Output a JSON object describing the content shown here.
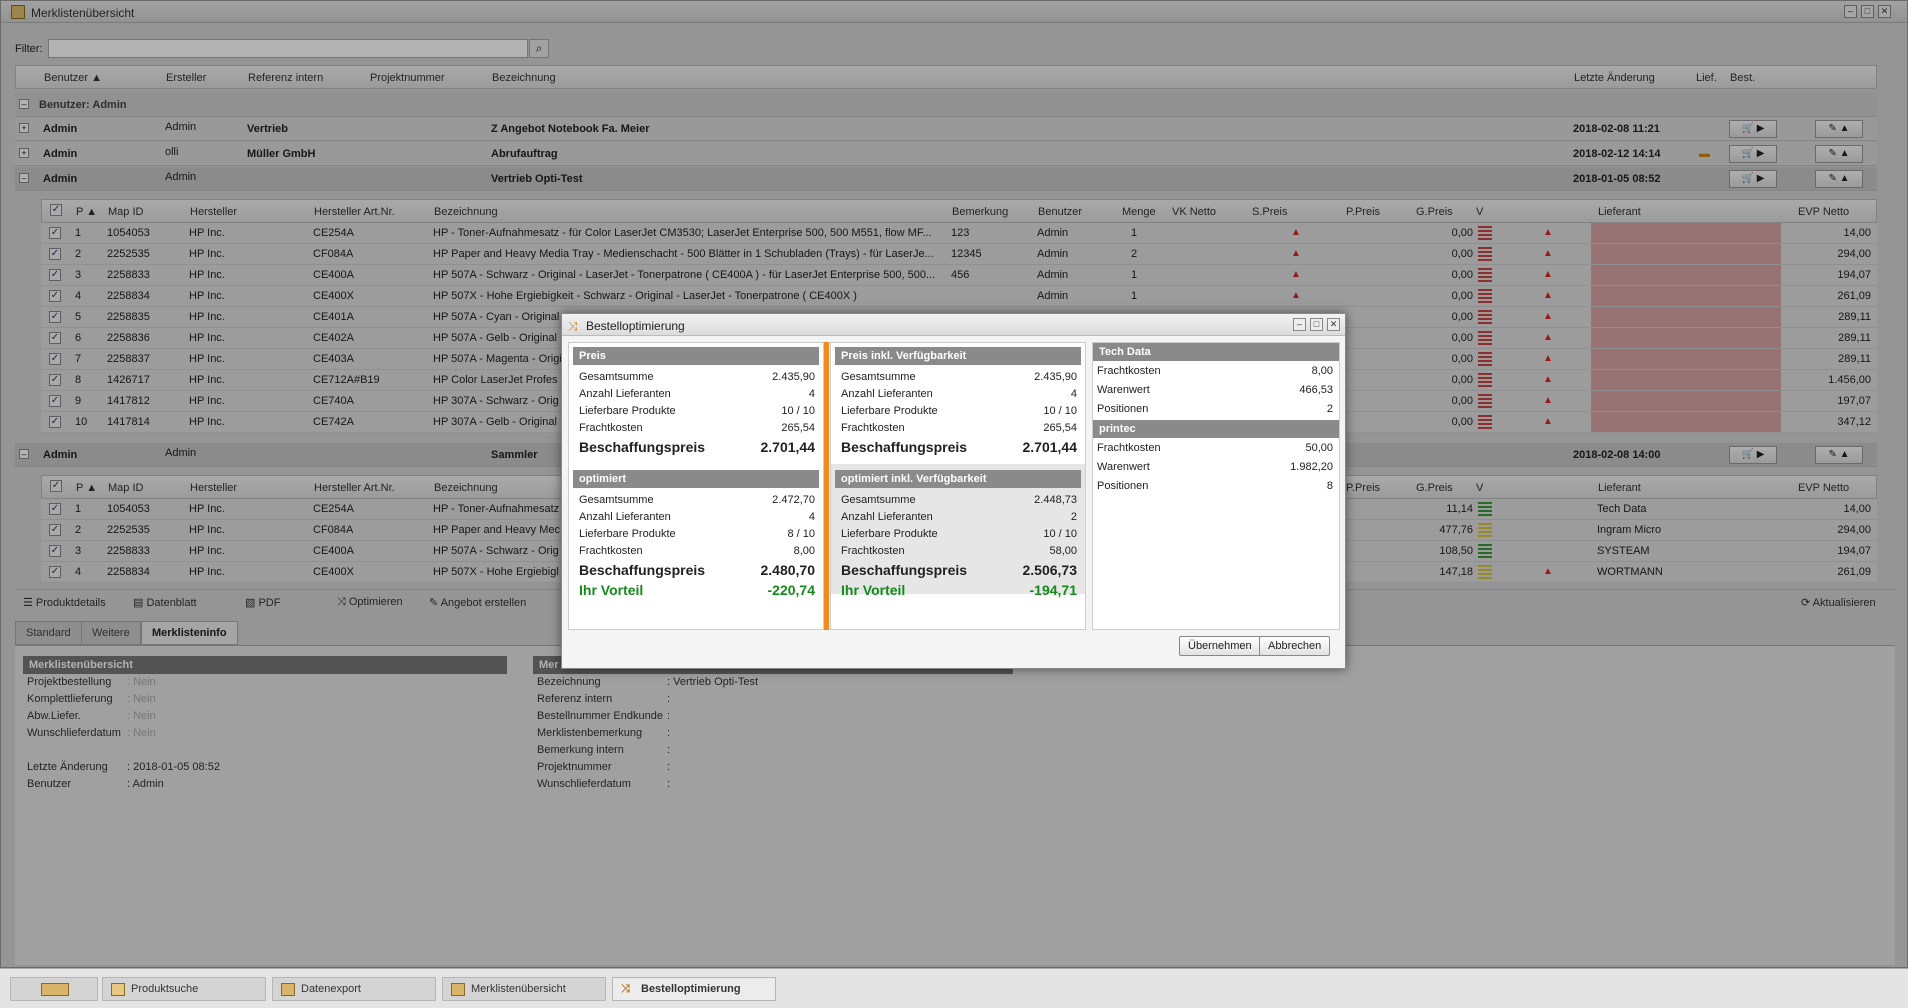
{
  "window": {
    "title": "Merklistenübersicht"
  },
  "filter": {
    "label": "Filter:",
    "value": ""
  },
  "grid": {
    "headers": [
      "Benutzer ▲",
      "Ersteller",
      "Referenz intern",
      "Projektnummer",
      "Bezeichnung",
      "Letzte Änderung",
      "Lief.",
      "Best."
    ],
    "group_label": "Benutzer: Admin",
    "groups": [
      {
        "benutzer": "Admin",
        "ersteller": "Admin",
        "referenz": "Vertrieb",
        "bezeichnung": "Z Angebot Notebook Fa. Meier",
        "date": "2018-02-08 11:21"
      },
      {
        "benutzer": "Admin",
        "ersteller": "olli",
        "referenz": "Müller GmbH",
        "bezeichnung": "Abrufauftrag",
        "date": "2018-02-12 14:14"
      },
      {
        "benutzer": "Admin",
        "ersteller": "Admin",
        "referenz": "",
        "bezeichnung": "Vertrieb Opti-Test",
        "date": "2018-01-05 08:52"
      },
      {
        "benutzer": "Admin",
        "ersteller": "Admin",
        "referenz": "",
        "bezeichnung": "Sammler",
        "date": "2018-02-08 14:00"
      }
    ]
  },
  "inner1": {
    "headers": [
      "P ▲",
      "Map ID",
      "Hersteller",
      "Hersteller Art.Nr.",
      "Bezeichnung",
      "Bemerkung",
      "Benutzer",
      "Menge",
      "VK Netto",
      "S.Preis",
      "P.Preis",
      "G.Preis",
      "V",
      "Lieferant",
      "EVP Netto"
    ],
    "rows": [
      {
        "p": "1",
        "map": "1054053",
        "her": "HP Inc.",
        "art": "CE254A",
        "bez": "HP - Toner-Aufnahmesatz - für Color LaserJet CM3530; LaserJet Enterprise 500, 500 M551, flow MF...",
        "bem": "123",
        "ben": "Admin",
        "menge": "1",
        "g": "0,00",
        "evp": "14,00"
      },
      {
        "p": "2",
        "map": "2252535",
        "her": "HP Inc.",
        "art": "CF084A",
        "bez": "HP Paper and Heavy Media Tray - Medienschacht - 500 Blätter in 1 Schubladen (Trays) - für LaserJe...",
        "bem": "12345",
        "ben": "Admin",
        "menge": "2",
        "g": "0,00",
        "evp": "294,00"
      },
      {
        "p": "3",
        "map": "2258833",
        "her": "HP Inc.",
        "art": "CE400A",
        "bez": "HP 507A - Schwarz - Original - LaserJet - Tonerpatrone ( CE400A ) - für LaserJet Enterprise 500, 500...",
        "bem": "456",
        "ben": "Admin",
        "menge": "1",
        "g": "0,00",
        "evp": "194,07"
      },
      {
        "p": "4",
        "map": "2258834",
        "her": "HP Inc.",
        "art": "CE400X",
        "bez": "HP 507X - Hohe Ergiebigkeit - Schwarz - Original - LaserJet - Tonerpatrone ( CE400X )",
        "bem": "",
        "ben": "Admin",
        "menge": "1",
        "g": "0,00",
        "evp": "261,09"
      },
      {
        "p": "5",
        "map": "2258835",
        "her": "HP Inc.",
        "art": "CE401A",
        "bez": "HP 507A - Cyan - Original",
        "bem": "",
        "ben": "",
        "menge": "",
        "g": "0,00",
        "evp": "289,11"
      },
      {
        "p": "6",
        "map": "2258836",
        "her": "HP Inc.",
        "art": "CE402A",
        "bez": "HP 507A - Gelb - Original",
        "bem": "",
        "ben": "",
        "menge": "",
        "g": "0,00",
        "evp": "289,11"
      },
      {
        "p": "7",
        "map": "2258837",
        "her": "HP Inc.",
        "art": "CE403A",
        "bez": "HP 507A - Magenta - Origi",
        "bem": "",
        "ben": "",
        "menge": "",
        "g": "0,00",
        "evp": "289,11"
      },
      {
        "p": "8",
        "map": "1426717",
        "her": "HP Inc.",
        "art": "CE712A#B19",
        "bez": "HP Color LaserJet Profes",
        "bem": "",
        "ben": "",
        "menge": "",
        "g": "0,00",
        "evp": "1.456,00"
      },
      {
        "p": "9",
        "map": "1417812",
        "her": "HP Inc.",
        "art": "CE740A",
        "bez": "HP 307A - Schwarz - Orig",
        "bem": "",
        "ben": "",
        "menge": "",
        "g": "0,00",
        "evp": "197,07"
      },
      {
        "p": "10",
        "map": "1417814",
        "her": "HP Inc.",
        "art": "CE742A",
        "bez": "HP 307A - Gelb - Original",
        "bem": "",
        "ben": "",
        "menge": "",
        "g": "0,00",
        "evp": "347,12"
      }
    ]
  },
  "inner2": {
    "headers": [
      "P ▲",
      "Map ID",
      "Hersteller",
      "Hersteller Art.Nr.",
      "Bezeichnung",
      "P.Preis",
      "G.Preis",
      "V",
      "Lieferant",
      "EVP Netto"
    ],
    "rows": [
      {
        "p": "1",
        "map": "1054053",
        "her": "HP Inc.",
        "art": "CE254A",
        "bez": "HP - Toner-Aufnahmesatz",
        "g": "11,14",
        "lief": "Tech Data",
        "evp": "14,00"
      },
      {
        "p": "2",
        "map": "2252535",
        "her": "HP Inc.",
        "art": "CF084A",
        "bez": "HP Paper and Heavy Mec",
        "g": "477,76",
        "lief": "Ingram Micro",
        "evp": "294,00"
      },
      {
        "p": "3",
        "map": "2258833",
        "her": "HP Inc.",
        "art": "CE400A",
        "bez": "HP 507A - Schwarz - Orig",
        "g": "108,50",
        "lief": "SYSTEAM",
        "evp": "194,07"
      },
      {
        "p": "4",
        "map": "2258834",
        "her": "HP Inc.",
        "art": "CE400X",
        "bez": "HP 507X - Hohe Ergiebigl",
        "g": "147,18",
        "lief": "WORTMANN",
        "evp": "261,09"
      }
    ]
  },
  "toolbar": {
    "items": [
      "Produktdetails",
      "Datenblatt",
      "PDF",
      "Optimieren",
      "Angebot erstellen"
    ],
    "refresh": "Aktualisieren"
  },
  "tabs": [
    "Standard",
    "Weitere",
    "Merklisteninfo"
  ],
  "info": {
    "left_title": "Merklistenübersicht",
    "left": [
      {
        "k": "Projektbestellung",
        "v": ": Nein"
      },
      {
        "k": "Komplettlieferung",
        "v": ": Nein"
      },
      {
        "k": "Abw.Liefer.",
        "v": ": Nein"
      },
      {
        "k": "Wunschlieferdatum",
        "v": ": Nein"
      },
      {
        "k": "Letzte Änderung",
        "v": ": 2018-01-05 08:52"
      },
      {
        "k": "Benutzer",
        "v": ": Admin"
      }
    ],
    "right_title": "Mer",
    "right": [
      {
        "k": "Bezeichnung",
        "v": ": Vertrieb Opti-Test"
      },
      {
        "k": "Referenz intern",
        "v": ":"
      },
      {
        "k": "Bestellnummer Endkunde",
        "v": ":"
      },
      {
        "k": "Merklistenbemerkung",
        "v": ":"
      },
      {
        "k": "Bemerkung intern",
        "v": ":"
      },
      {
        "k": "Projektnummer",
        "v": ":"
      },
      {
        "k": "Wunschlieferdatum",
        "v": ":"
      }
    ]
  },
  "taskbar": [
    "Produktsuche",
    "Datenexport",
    "Merklistenübersicht",
    "Bestelloptimierung"
  ],
  "modal": {
    "title": "Bestelloptimierung",
    "preis": {
      "title": "Preis",
      "rows": [
        {
          "k": "Gesamtsumme",
          "v": "2.435,90"
        },
        {
          "k": "Anzahl Lieferanten",
          "v": "4"
        },
        {
          "k": "Lieferbare Produkte",
          "v": "10 / 10"
        },
        {
          "k": "Frachtkosten",
          "v": "265,54"
        }
      ],
      "total_k": "Beschaffungspreis",
      "total_v": "2.701,44"
    },
    "optimiert": {
      "title": "optimiert",
      "rows": [
        {
          "k": "Gesamtsumme",
          "v": "2.472,70"
        },
        {
          "k": "Anzahl Lieferanten",
          "v": "4"
        },
        {
          "k": "Lieferbare Produkte",
          "v": "8 / 10"
        },
        {
          "k": "Frachtkosten",
          "v": "8,00"
        }
      ],
      "total_k": "Beschaffungspreis",
      "total_v": "2.480,70",
      "vorteil_k": "Ihr Vorteil",
      "vorteil_v": "-220,74"
    },
    "preis_v": {
      "title": "Preis inkl. Verfügbarkeit",
      "rows": [
        {
          "k": "Gesamtsumme",
          "v": "2.435,90"
        },
        {
          "k": "Anzahl Lieferanten",
          "v": "4"
        },
        {
          "k": "Lieferbare Produkte",
          "v": "10 / 10"
        },
        {
          "k": "Frachtkosten",
          "v": "265,54"
        }
      ],
      "total_k": "Beschaffungspreis",
      "total_v": "2.701,44"
    },
    "optimiert_v": {
      "title": "optimiert inkl. Verfügbarkeit",
      "rows": [
        {
          "k": "Gesamtsumme",
          "v": "2.448,73"
        },
        {
          "k": "Anzahl Lieferanten",
          "v": "2"
        },
        {
          "k": "Lieferbare Produkte",
          "v": "10 / 10"
        },
        {
          "k": "Frachtkosten",
          "v": "58,00"
        }
      ],
      "total_k": "Beschaffungspreis",
      "total_v": "2.506,73",
      "vorteil_k": "Ihr Vorteil",
      "vorteil_v": "-194,71"
    },
    "suppliers": [
      {
        "name": "Tech Data",
        "rows": [
          {
            "k": "Frachtkosten",
            "v": "8,00"
          },
          {
            "k": "Warenwert",
            "v": "466,53"
          },
          {
            "k": "Positionen",
            "v": "2"
          }
        ]
      },
      {
        "name": "printec",
        "rows": [
          {
            "k": "Frachtkosten",
            "v": "50,00"
          },
          {
            "k": "Warenwert",
            "v": "1.982,20"
          },
          {
            "k": "Positionen",
            "v": "8"
          }
        ]
      }
    ],
    "ok": "Übernehmen",
    "cancel": "Abbrechen"
  }
}
